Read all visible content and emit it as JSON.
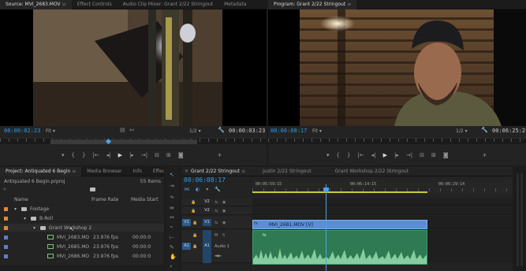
{
  "source_panel": {
    "tabs": [
      "Source: MVI_2683.MOV",
      "Effect Controls",
      "Audio Clip Mixer: Grant 2/22 Stringout",
      "Metadata"
    ],
    "timecode_left": "00:00:02:23",
    "fit": "Fit",
    "ratio": "1/2",
    "timecode_right": "00:00:03:23"
  },
  "program_panel": {
    "tab": "Program: Grant 2/22 Stringout",
    "timecode_left": "00:06:08:17",
    "fit": "Fit",
    "ratio": "1/2",
    "timecode_right": "00:06:25:2"
  },
  "project_panel": {
    "tabs": [
      "Project: Antiquated 6 Begin",
      "Media Browser",
      "Info",
      "Effects"
    ],
    "file": "Antiquated 6 Begin.prproj",
    "items_count": "55 Items",
    "columns": [
      "Name",
      "Frame Rate",
      "Media Start"
    ],
    "rows": [
      {
        "name": "Footage",
        "rate": "",
        "start": "",
        "swatch": "#e0893a",
        "indent": 0,
        "type": "folder"
      },
      {
        "name": "B-Roll",
        "rate": "",
        "start": "",
        "swatch": "#e0893a",
        "indent": 1,
        "type": "folder"
      },
      {
        "name": "Grant Workshop 2",
        "rate": "",
        "start": "",
        "swatch": "#e0893a",
        "indent": 2,
        "type": "folder"
      },
      {
        "name": "MVI_2683.MO",
        "rate": "23.976 fps",
        "start": "00:00:0",
        "swatch": "#5e7ec6",
        "indent": 3,
        "type": "clip"
      },
      {
        "name": "MVI_2685.MO",
        "rate": "23.976 fps",
        "start": "00:00:0",
        "swatch": "#5e7ec6",
        "indent": 3,
        "type": "clip"
      },
      {
        "name": "MVI_2686.MO",
        "rate": "23.976 fps",
        "start": "00:00:0",
        "swatch": "#5e7ec6",
        "indent": 3,
        "type": "clip"
      }
    ]
  },
  "timeline": {
    "tabs": [
      "Grant 2/22 Stringout",
      "Justin 2/22 Stringout",
      "Grant Workshop 2/22 Stringout"
    ],
    "timecode": "00:06:08:17",
    "ruler_labels": [
      "00:05:59:15",
      "00:06:14:15",
      "00:06:29:14"
    ],
    "tracks": {
      "v2": "V2",
      "v2b": "V2",
      "v1_src": "V1",
      "v1": "V1",
      "a1_src": "A1",
      "a1": "A1",
      "audio1": "Audio 1"
    },
    "clip_name": "MVI_2681.MOV [V]",
    "fx": "fx"
  },
  "colors": {
    "accent": "#2f9ae6",
    "video_clip": "#5a8fd6",
    "audio_clip": "#2f7a52",
    "audio_wave": "#9ee0b0"
  }
}
